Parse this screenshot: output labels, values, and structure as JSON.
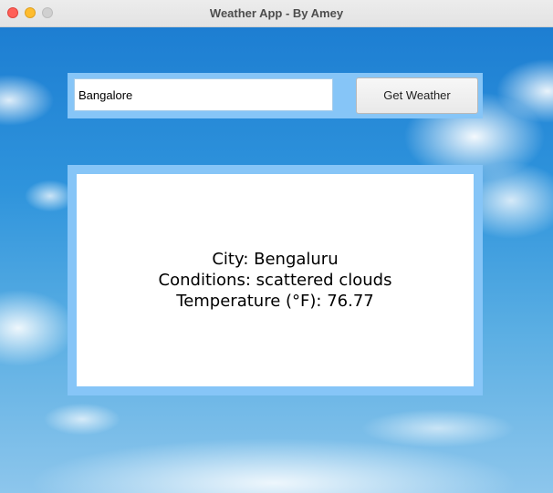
{
  "window": {
    "title": "Weather App - By Amey"
  },
  "search": {
    "value": "Bangalore",
    "button_label": "Get Weather"
  },
  "result": {
    "city_line": "City: Bengaluru",
    "conditions_line": "Conditions: scattered clouds",
    "temperature_line": "Temperature (°F): 76.77"
  },
  "colors": {
    "panel_accent": "#86c5f7",
    "close_button": "#ff5f57",
    "minimize_button": "#febc2e",
    "zoom_button": "#d0d0d0"
  }
}
